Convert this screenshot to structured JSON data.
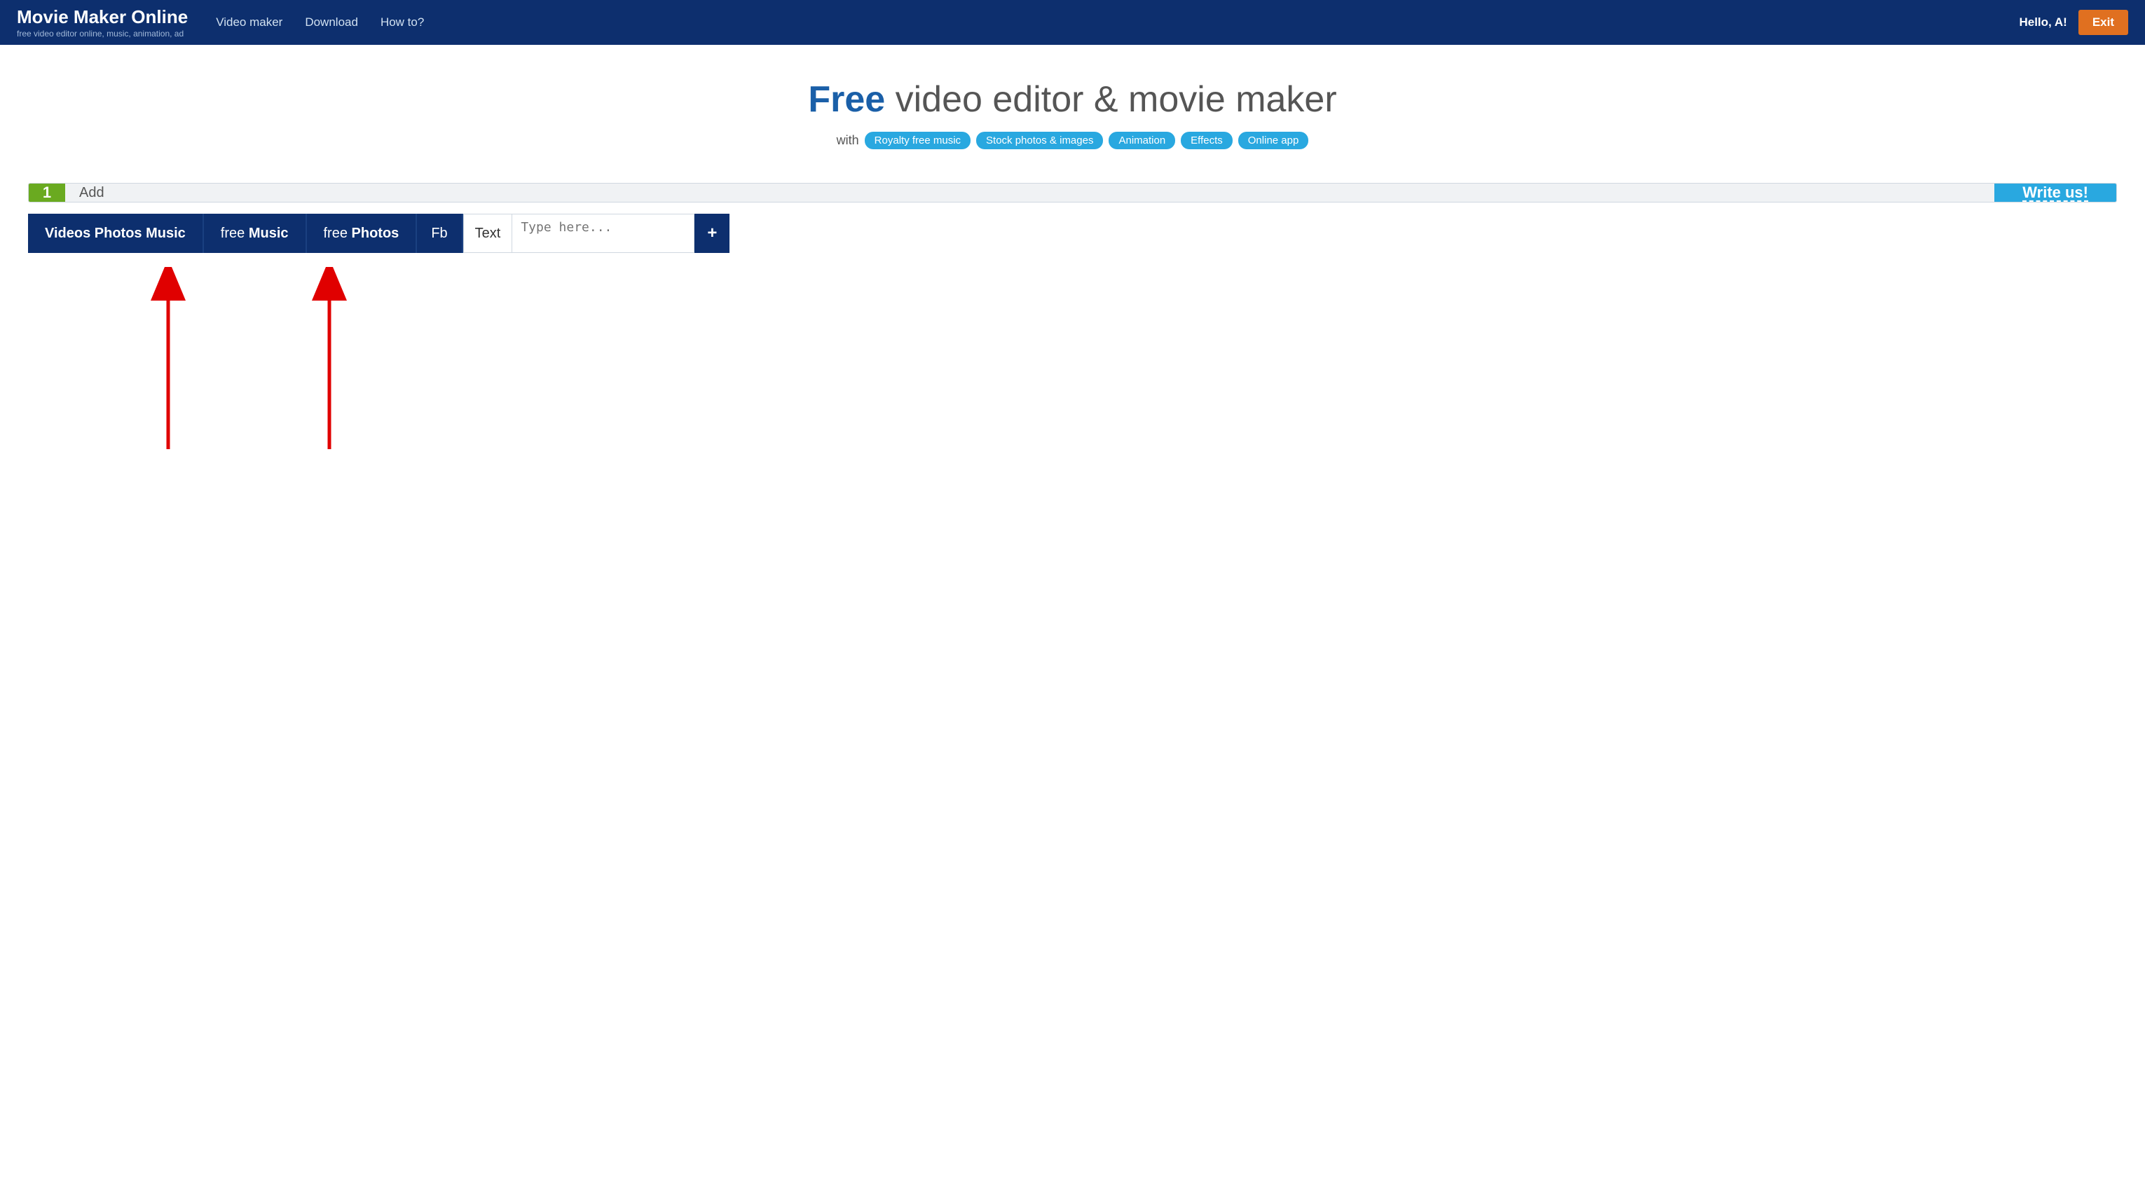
{
  "navbar": {
    "brand_title": "Movie Maker Online",
    "brand_subtitle": "free video editor online, music, animation, ad",
    "links": [
      "Video maker",
      "Download",
      "How to?"
    ],
    "hello_text": "Hello, ",
    "hello_user": "A!",
    "exit_label": "Exit"
  },
  "hero": {
    "title_strong": "Free",
    "title_rest": " video editor & movie maker",
    "with_text": "with",
    "badges": [
      "Royalty free music",
      "Stock photos & images",
      "Animation",
      "Effects",
      "Online app"
    ]
  },
  "add_bar": {
    "number": "1",
    "label": "Add",
    "write_btn": "Write us!"
  },
  "toolbar": {
    "btn_videos": "Videos Photos Music",
    "btn_free_music_prefix": "free ",
    "btn_free_music_bold": "Music",
    "btn_free_photos_prefix": "free ",
    "btn_free_photos_bold": "Photos",
    "btn_fb": "Fb",
    "text_label": "Text",
    "text_placeholder": "Type here...",
    "plus_label": "+"
  }
}
